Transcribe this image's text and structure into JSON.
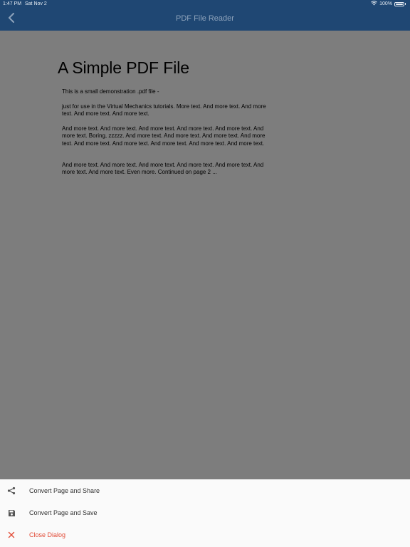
{
  "status_bar": {
    "time": "1:47 PM",
    "date": "Sat Nov 2",
    "battery": "100%"
  },
  "nav": {
    "title": "PDF File Reader",
    "back_icon": "chevron-left-icon"
  },
  "document": {
    "title": "A Simple PDF File",
    "paragraphs": [
      "This is a small demonstration .pdf file -",
      "just for use in the Virtual Mechanics tutorials. More text. And more text. And more text. And more text. And more text.",
      "And more text. And more text. And more text. And more text. And more text. And more text. Boring, zzzzz. And more text. And more text. And more text. And more text. And more text. And more text. And more text. And more text. And more text.",
      "And more text. And more text. And more text. And more text. And more text. And more text. And more text. Even more. Continued on page 2 ..."
    ]
  },
  "sheet": {
    "items": [
      {
        "label": "Convert Page and Share",
        "icon": "share-icon"
      },
      {
        "label": "Convert Page and Save",
        "icon": "save-icon"
      },
      {
        "label": "Close Dialog",
        "icon": "close-icon"
      }
    ]
  },
  "colors": {
    "header": "#1f4773",
    "overlay": "#7d7d7d",
    "sheet": "#fafafa",
    "danger": "#e24a35"
  }
}
